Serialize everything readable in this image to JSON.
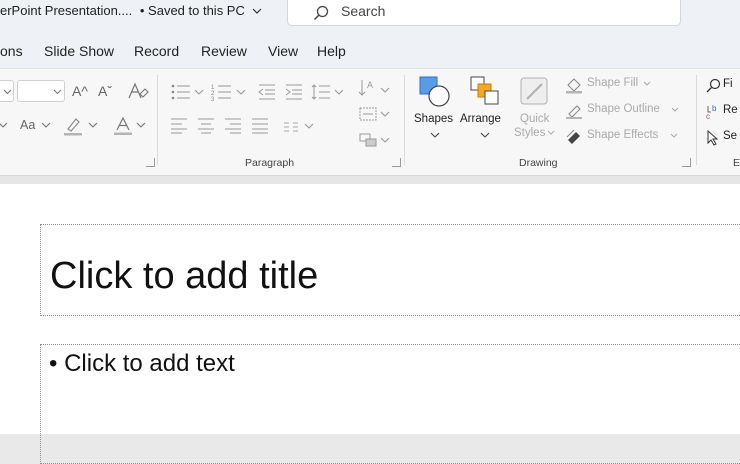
{
  "titlebar": {
    "doc_title": "erPoint Presentation....",
    "saved_status": "• Saved to this PC",
    "search_placeholder": "Search"
  },
  "menu": {
    "items": [
      "ons",
      "Slide Show",
      "Record",
      "Review",
      "View",
      "Help"
    ]
  },
  "ribbon": {
    "font": {
      "grow_label": "A^",
      "shrink_label": "Aˇ",
      "case_label": "Aa"
    },
    "paragraph": {
      "group_label": "Paragraph"
    },
    "drawing": {
      "group_label": "Drawing",
      "shapes_label": "Shapes",
      "arrange_label": "Arrange",
      "quick_styles_line1": "Quick",
      "quick_styles_line2": "Styles",
      "shape_fill_label": "Shape Fill",
      "shape_outline_label": "Shape Outline",
      "shape_effects_label": "Shape Effects"
    },
    "editing": {
      "find_label": "Fi",
      "replace_label": "Re",
      "select_label": "Se",
      "group_label": "E"
    }
  },
  "slide": {
    "title_placeholder": "Click to add title",
    "body_placeholder": "• Click to add text"
  },
  "colors": {
    "accent_blue": "#2b6fd6",
    "shape_orange": "#f5a623",
    "ribbon_bg": "#f7f7f7",
    "titlebar_bg": "#eef1f6"
  }
}
